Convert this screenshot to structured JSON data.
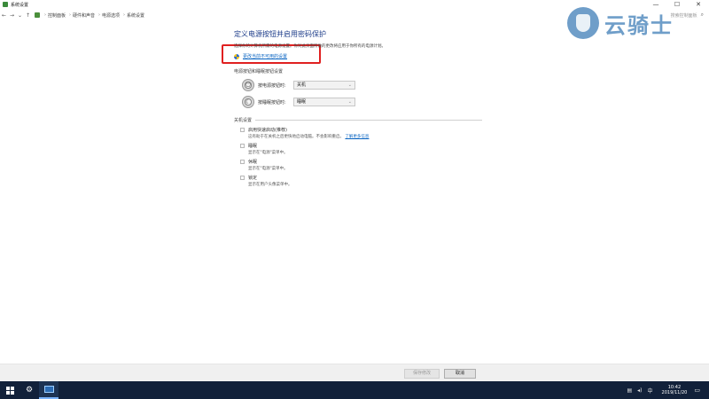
{
  "window": {
    "title": "系统设置",
    "controls": {
      "minimize": "—",
      "maximize": "☐",
      "close": "✕"
    }
  },
  "address": {
    "crumbs": [
      "控制面板",
      "硬件和声音",
      "电源选项",
      "系统设置"
    ],
    "search_placeholder": "搜索控制面板"
  },
  "watermark": {
    "text": "云骑士"
  },
  "page": {
    "title": "定义电源按钮并启用密码保护",
    "description": "选择你的计算机所需的电源设置。你对此页面所做的更改将应用于你所有的电源计划。",
    "change_link": "更改当前不可用的设置",
    "power_section_label": "电源按钮和睡眠按钮设置",
    "power_button_label": "按电源按钮时:",
    "power_button_value": "关机",
    "sleep_button_label": "按睡眠按钮时:",
    "sleep_button_value": "睡眠",
    "shutdown_section_label": "关机设置",
    "options": [
      {
        "title": "启用快速启动(推荐)",
        "desc": "这有助于在关机之后更快地启动电脑。不会影响重启。",
        "link": "了解更多信息"
      },
      {
        "title": "睡眠",
        "desc": "显示在\"电源\"菜单中。"
      },
      {
        "title": "休眠",
        "desc": "显示在\"电源\"菜单中。"
      },
      {
        "title": "锁定",
        "desc": "显示在用户头像菜单中。"
      }
    ]
  },
  "buttons": {
    "save": "保存修改",
    "cancel": "取消"
  },
  "taskbar": {
    "time": "10:42",
    "date": "2019/11/20",
    "ime": "中",
    "tray_icons": [
      "network-icon",
      "volume-icon",
      "ime-icon"
    ]
  },
  "colors": {
    "title_blue": "#1e3d8a",
    "link_blue": "#0b65c2",
    "highlight_red": "#e02020",
    "taskbar": "#12213a"
  }
}
